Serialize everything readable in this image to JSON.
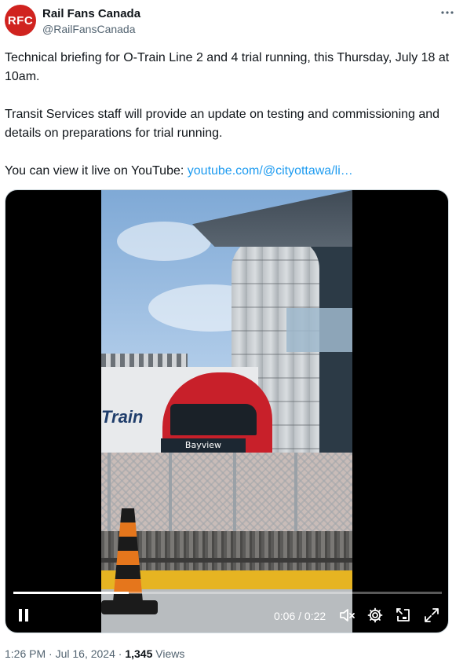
{
  "author": {
    "avatar_text": "RFC",
    "display_name": "Rail Fans Canada",
    "handle": "@RailFansCanada"
  },
  "tweet": {
    "para1": "Technical briefing for O-Train Line 2 and 4 trial running, this Thursday, July 18 at 10am.",
    "para2": "Transit Services staff will provide an update on testing and commissioning and details on preparations for trial running.",
    "para3_prefix": "You can view it live on YouTube: ",
    "link_text": "youtube.com/@cityottawa/li…"
  },
  "video": {
    "sign_text": "Bayview",
    "logo_text": "Train",
    "current_time": "0:06",
    "duration": "0:22",
    "time_separator": " / ",
    "progress_fraction": 0.27
  },
  "meta": {
    "time": "1:26 PM",
    "date": "Jul 16, 2024",
    "separator": " · ",
    "views_count": "1,345",
    "views_label": "Views"
  },
  "icons": {
    "more": "more-icon",
    "pause": "pause-icon",
    "mute": "volume-muted-icon",
    "settings": "gear-icon",
    "pip": "picture-in-picture-icon",
    "fullscreen": "fullscreen-icon"
  },
  "colors": {
    "link": "#1d9bf0",
    "avatar_bg": "#d0231f",
    "secondary_text": "#536471"
  }
}
